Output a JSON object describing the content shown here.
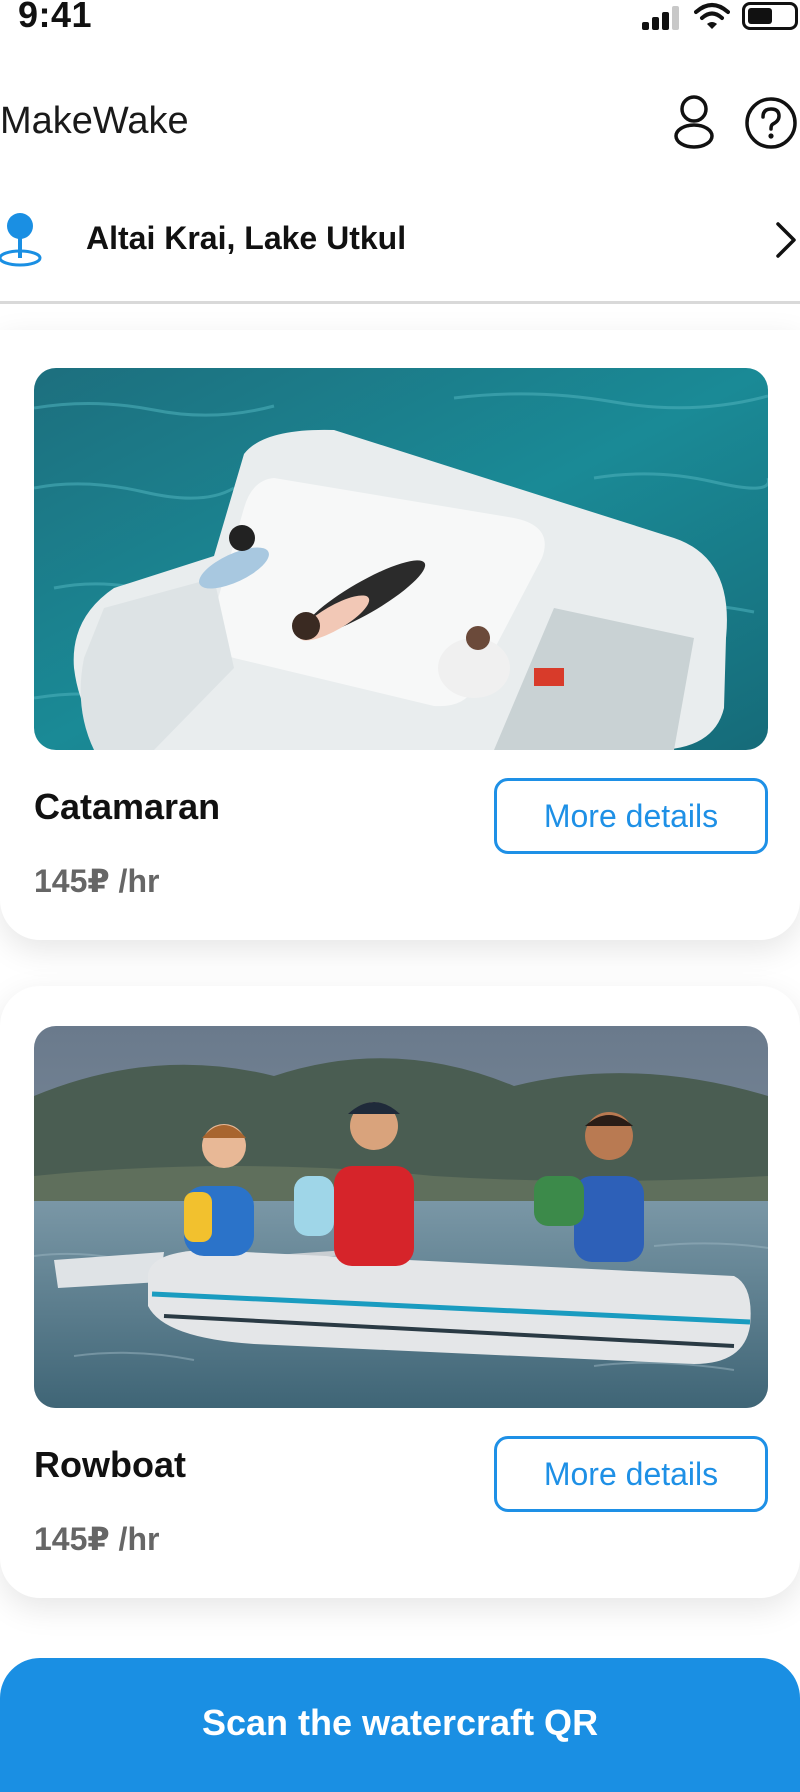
{
  "status_bar": {
    "time": "9:41",
    "icons": [
      "signal-icon",
      "wifi-icon",
      "battery-icon"
    ]
  },
  "header": {
    "title": "MakeWake",
    "icons": [
      "user-icon",
      "help-icon"
    ]
  },
  "location": {
    "label": "Altai Krai, Lake Utkul",
    "icon": "location-pin-icon"
  },
  "watercraft": [
    {
      "name": "Catamaran",
      "price": "145₽ /hr",
      "details_label": "More details",
      "image": "inflatable catamaran with people on turquoise water"
    },
    {
      "name": "Rowboat",
      "price": "145₽ /hr",
      "details_label": "More details",
      "image": "three people in an inflatable rowboat on a lake"
    }
  ],
  "scan_button": {
    "label": "Scan the watercraft QR"
  },
  "colors": {
    "accent": "#1a8fe3",
    "button_border": "#1e90e6",
    "price_text": "#666666"
  }
}
